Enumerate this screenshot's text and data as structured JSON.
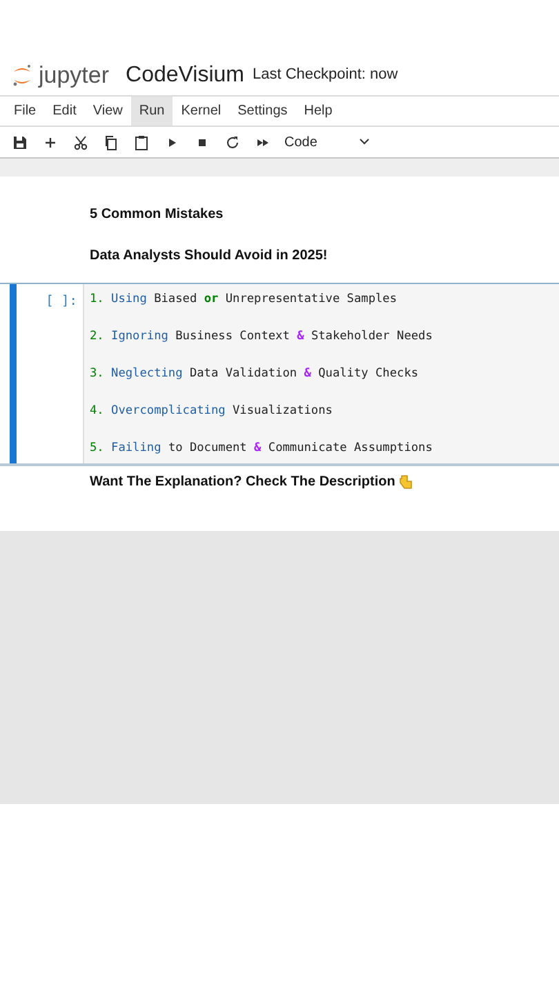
{
  "header": {
    "logo_text": "jupyter",
    "notebook_name": "CodeVisium",
    "checkpoint": "Last Checkpoint: now"
  },
  "menu": [
    {
      "label": "File",
      "selected": false
    },
    {
      "label": "Edit",
      "selected": false
    },
    {
      "label": "View",
      "selected": false
    },
    {
      "label": "Run",
      "selected": true
    },
    {
      "label": "Kernel",
      "selected": false
    },
    {
      "label": "Settings",
      "selected": false
    },
    {
      "label": "Help",
      "selected": false
    }
  ],
  "toolbar": {
    "tools": [
      {
        "kind": "save"
      },
      {
        "kind": "add"
      },
      {
        "kind": "cut"
      },
      {
        "kind": "copy"
      },
      {
        "kind": "paste"
      },
      {
        "kind": "run"
      },
      {
        "kind": "stop"
      },
      {
        "kind": "restart"
      },
      {
        "kind": "fast-forward"
      }
    ],
    "cell_type": "Code"
  },
  "markdown_top": [
    "5 Common Mistakes",
    "Data Analysts Should Avoid in 2025!"
  ],
  "code_cell": {
    "prompt": "[ ]:",
    "active": true,
    "lines": [
      [
        {
          "kind": "number",
          "text": "1."
        },
        {
          "kind": "name",
          "text": " Using"
        },
        {
          "kind": "plain",
          "text": " Biased "
        },
        {
          "kind": "keyword",
          "text": "or"
        },
        {
          "kind": "plain",
          "text": " Unrepresentative Samples"
        }
      ],
      [
        {
          "kind": "number",
          "text": "2."
        },
        {
          "kind": "name",
          "text": " Ignoring"
        },
        {
          "kind": "plain",
          "text": " Business Context "
        },
        {
          "kind": "operator",
          "text": "&"
        },
        {
          "kind": "plain",
          "text": " Stakeholder Needs"
        }
      ],
      [
        {
          "kind": "number",
          "text": "3."
        },
        {
          "kind": "name",
          "text": " Neglecting"
        },
        {
          "kind": "plain",
          "text": " Data Validation "
        },
        {
          "kind": "operator",
          "text": "&"
        },
        {
          "kind": "plain",
          "text": " Quality Checks"
        }
      ],
      [
        {
          "kind": "number",
          "text": "4."
        },
        {
          "kind": "name",
          "text": " Overcomplicating"
        },
        {
          "kind": "plain",
          "text": " Visualizations"
        }
      ],
      [
        {
          "kind": "number",
          "text": "5."
        },
        {
          "kind": "name",
          "text": " Failing"
        },
        {
          "kind": "plain",
          "text": " to Document "
        },
        {
          "kind": "operator",
          "text": "&"
        },
        {
          "kind": "plain",
          "text": " Communicate Assumptions"
        }
      ]
    ]
  },
  "markdown_bottom": "Want The Explanation? Check The Description"
}
